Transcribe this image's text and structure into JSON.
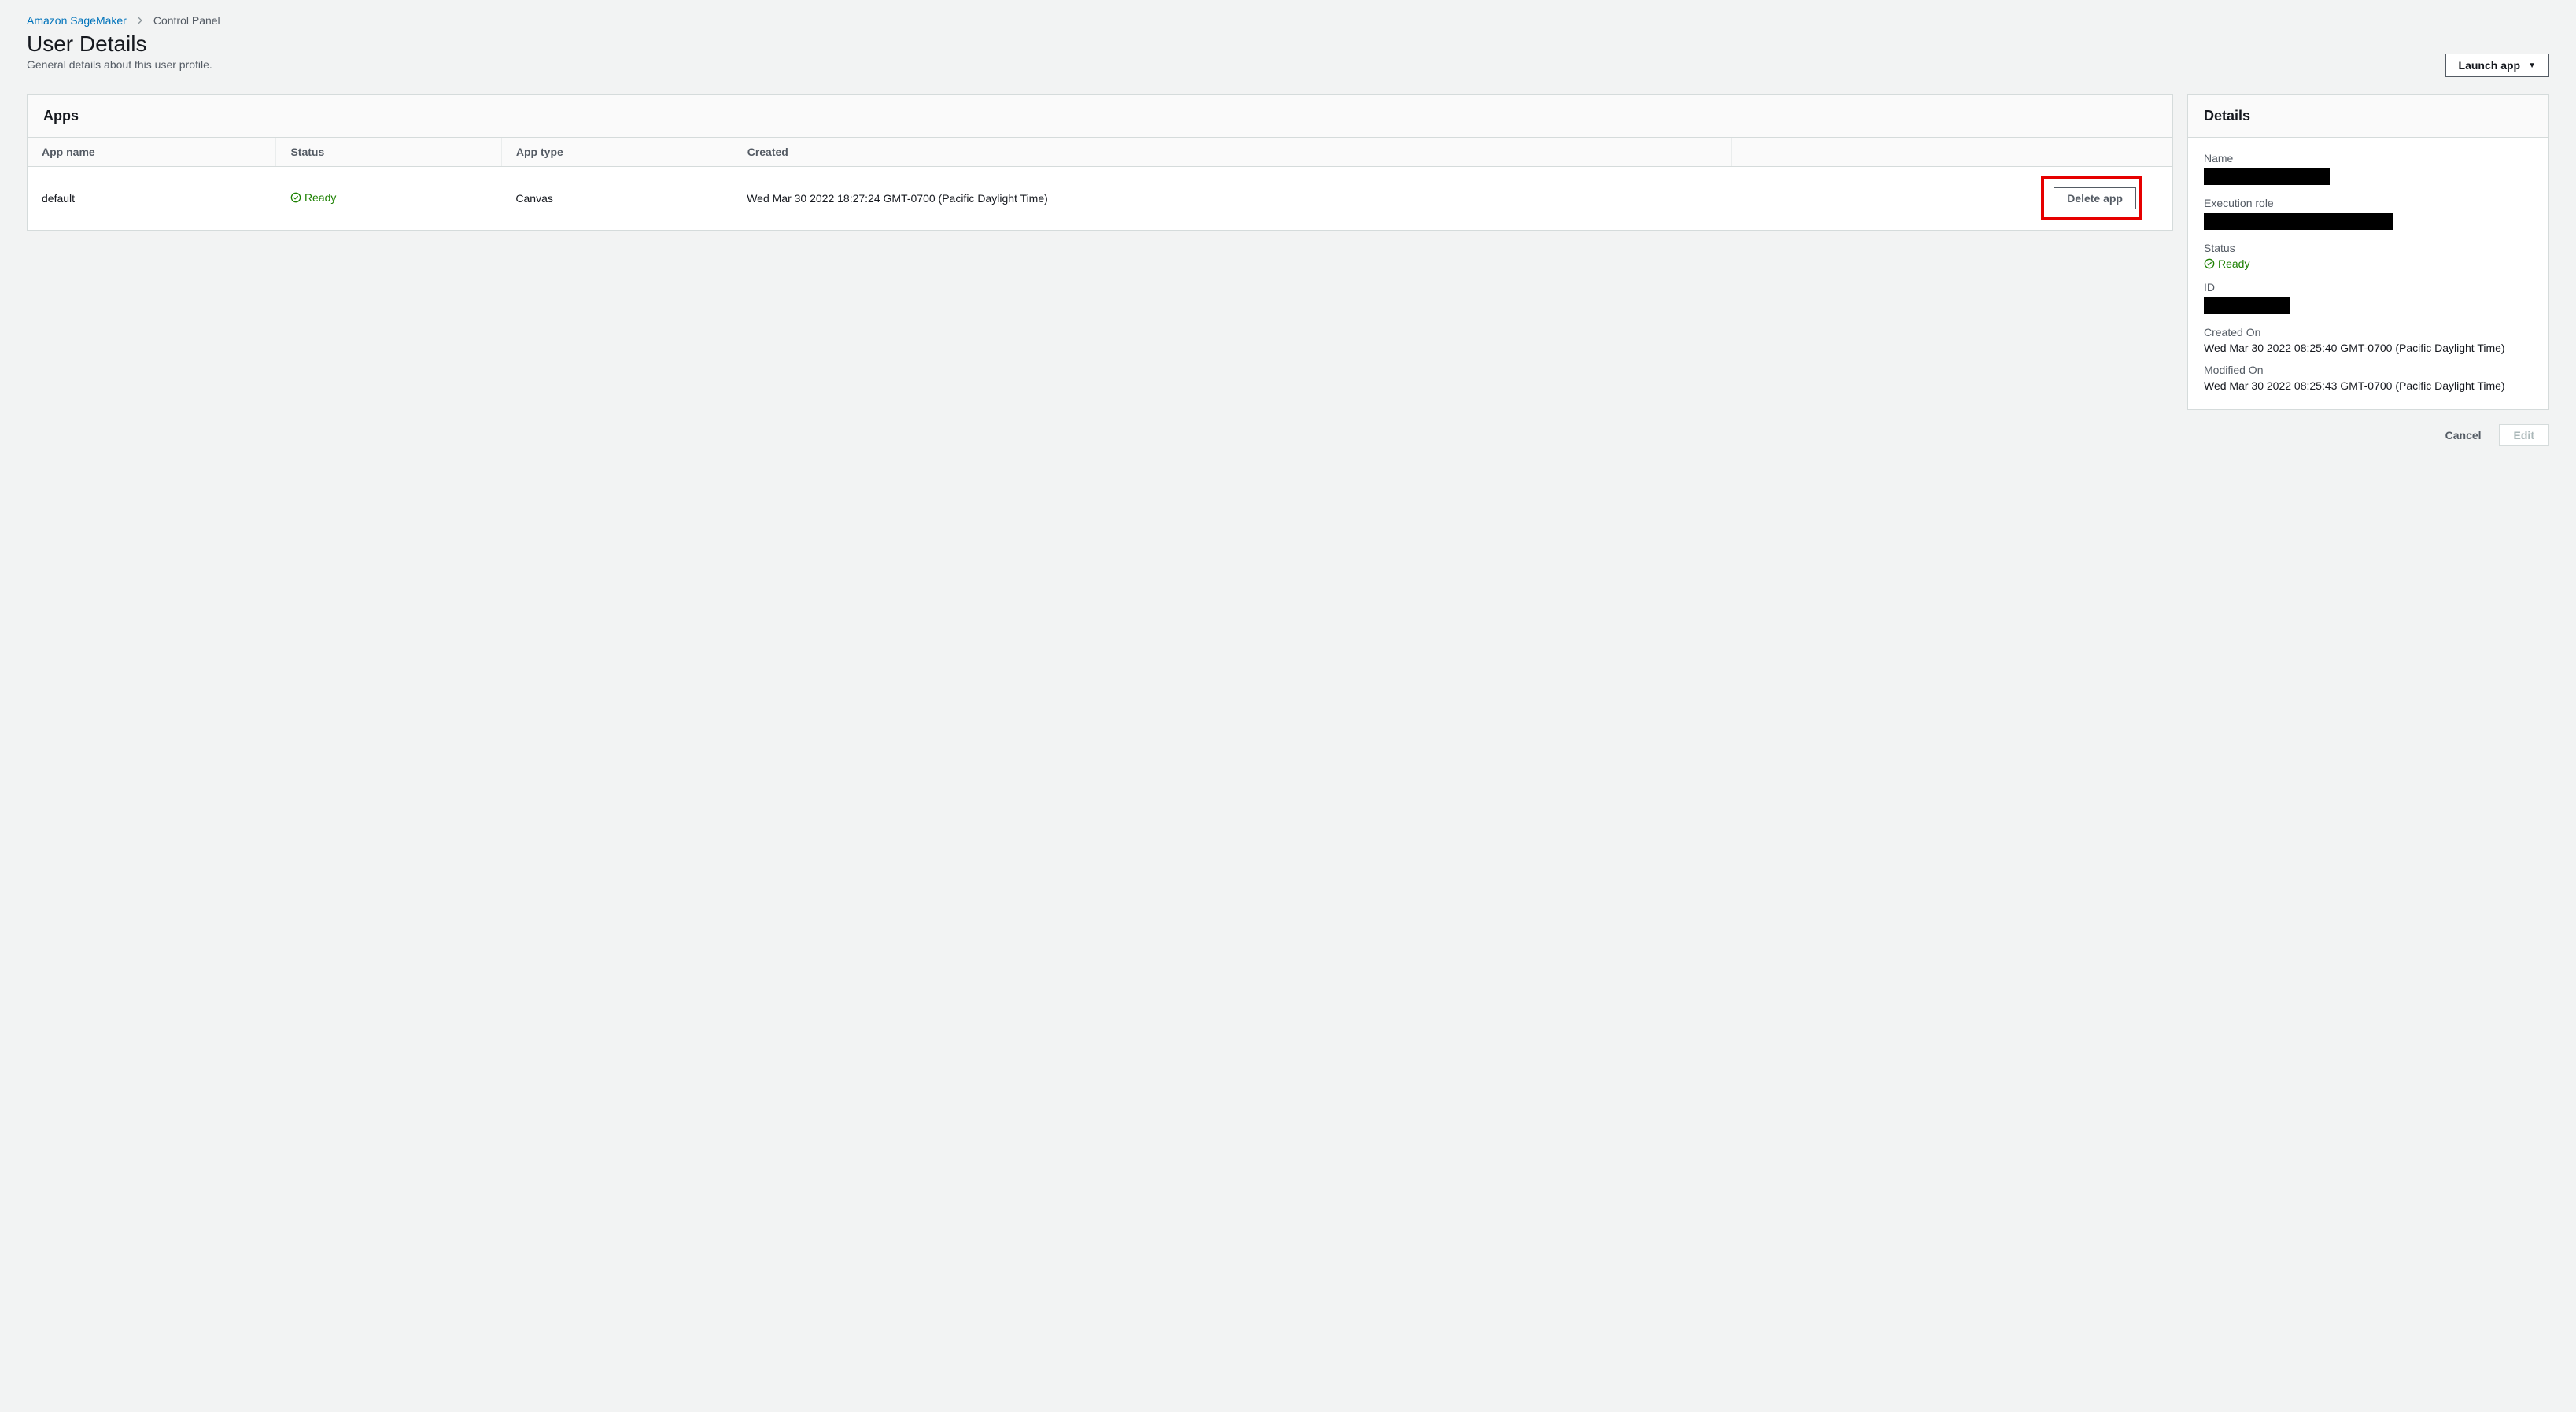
{
  "breadcrumb": {
    "root": "Amazon SageMaker",
    "current": "Control Panel"
  },
  "page": {
    "title": "User Details",
    "subtitle": "General details about this user profile.",
    "launch_label": "Launch app"
  },
  "apps": {
    "heading": "Apps",
    "columns": {
      "app_name": "App name",
      "status": "Status",
      "app_type": "App type",
      "created": "Created"
    },
    "rows": [
      {
        "app_name": "default",
        "status": "Ready",
        "app_type": "Canvas",
        "created": "Wed Mar 30 2022 18:27:24 GMT-0700 (Pacific Daylight Time)",
        "delete_label": "Delete app"
      }
    ]
  },
  "details": {
    "heading": "Details",
    "labels": {
      "name": "Name",
      "execution_role": "Execution role",
      "status": "Status",
      "id": "ID",
      "created_on": "Created On",
      "modified_on": "Modified On"
    },
    "status_value": "Ready",
    "created_on_value": "Wed Mar 30 2022 08:25:40 GMT-0700 (Pacific Daylight Time)",
    "modified_on_value": "Wed Mar 30 2022 08:25:43 GMT-0700 (Pacific Daylight Time)"
  },
  "actions": {
    "cancel": "Cancel",
    "edit": "Edit"
  }
}
